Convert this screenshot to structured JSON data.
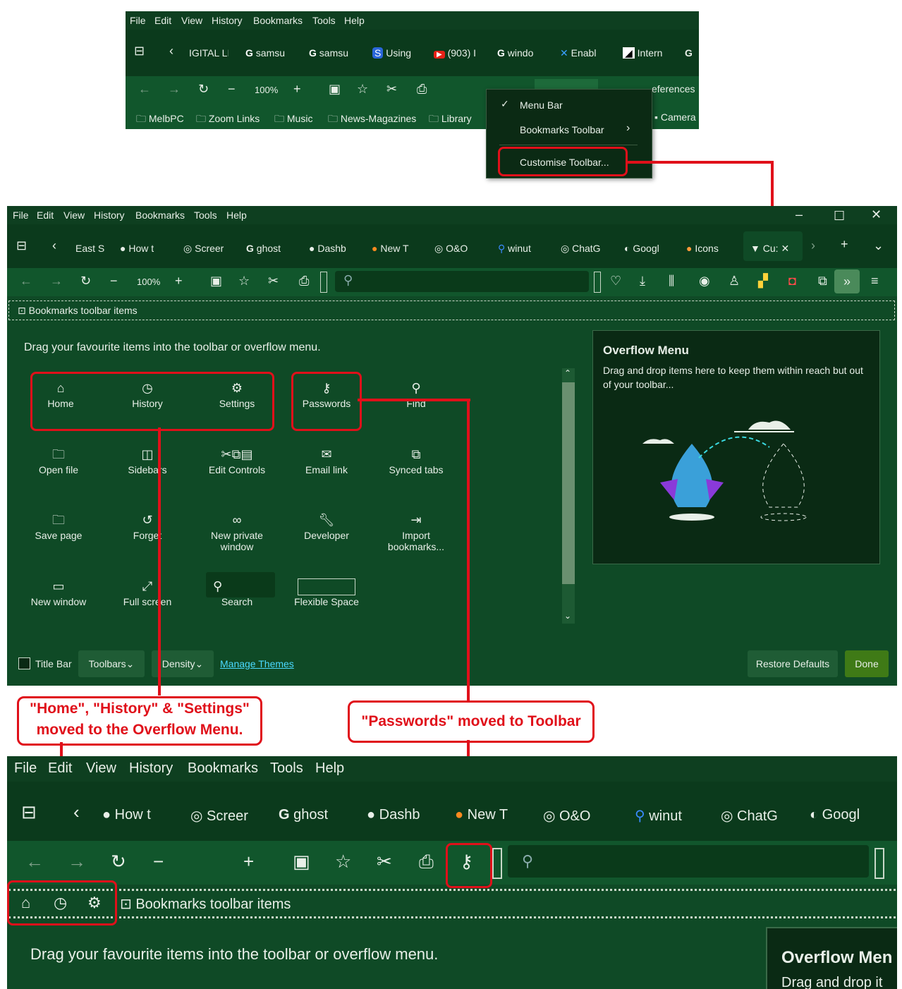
{
  "menu_bar": {
    "file": "File",
    "edit": "Edit",
    "view": "View",
    "history": "History",
    "bookmarks": "Bookmarks",
    "tools": "Tools",
    "help": "Help"
  },
  "shotA": {
    "tabs": [
      "IGITAL LI",
      "samsu",
      "samsu",
      "Using",
      "(903) I",
      "windo",
      "Enabl",
      "Intern"
    ],
    "zoom": "100%",
    "overlay_text": "eferences",
    "bookmarks": [
      "MelbPC",
      "Zoom Links",
      "Music",
      "News-Magazines",
      "Library",
      "Camera"
    ]
  },
  "context_menu": {
    "items": [
      "Menu Bar",
      "Bookmarks Toolbar",
      "Customise Toolbar..."
    ]
  },
  "shotB": {
    "tabs": [
      "East S",
      "How t",
      "Screer",
      "ghost",
      "Dashb",
      "New T",
      "O&O",
      "winut",
      "ChatG",
      "Googl",
      "Icons",
      "Cu:"
    ],
    "zoom": "100%",
    "bookmarks_toolbar_label": "Bookmarks toolbar items",
    "drag_instruction": "Drag your favourite items into the toolbar or overflow menu.",
    "items": [
      {
        "label": "Home",
        "icon": "home-icon"
      },
      {
        "label": "History",
        "icon": "clock-icon"
      },
      {
        "label": "Settings",
        "icon": "gear-icon"
      },
      {
        "label": "Passwords",
        "icon": "key-icon"
      },
      {
        "label": "Find",
        "icon": "search-icon"
      },
      {
        "label": "Open file",
        "icon": "open-file-icon"
      },
      {
        "label": "Sidebars",
        "icon": "sidebar-icon"
      },
      {
        "label": "Edit Controls",
        "icon": "edit-controls-icon"
      },
      {
        "label": "Email link",
        "icon": "email-icon"
      },
      {
        "label": "Synced tabs",
        "icon": "synced-tabs-icon"
      },
      {
        "label": "Save page",
        "icon": "save-page-icon"
      },
      {
        "label": "Forget",
        "icon": "forget-icon"
      },
      {
        "label": "New private window",
        "icon": "private-mask-icon"
      },
      {
        "label": "Developer",
        "icon": "wrench-icon"
      },
      {
        "label": "Import bookmarks...",
        "icon": "import-icon"
      },
      {
        "label": "New window",
        "icon": "window-icon"
      },
      {
        "label": "Full screen",
        "icon": "fullscreen-icon"
      },
      {
        "label": "Search",
        "icon": "search-icon"
      },
      {
        "label": "Flexible Space",
        "icon": "flexible-space-icon"
      }
    ],
    "overflow_title": "Overflow Menu",
    "overflow_desc": "Drag and drop items here to keep them within reach but out of your toolbar...",
    "footer": {
      "title_bar": "Title Bar",
      "toolbars": "Toolbars",
      "density": "Density",
      "manage_themes": "Manage Themes",
      "restore": "Restore Defaults",
      "done": "Done"
    }
  },
  "callouts": {
    "left": "\"Home\", \"History\" & \"Settings\" moved to the Overflow Menu.",
    "right": "\"Passwords\" moved to Toolbar"
  },
  "shotC": {
    "tabs": [
      "How t",
      "Screer",
      "ghost",
      "Dashb",
      "New T",
      "O&O",
      "winut",
      "ChatG",
      "Googl"
    ],
    "bookmarks_toolbar_label": "Bookmarks toolbar items",
    "drag_instruction": "Drag your favourite items into the toolbar or overflow menu.",
    "overflow_title": "Overflow Men",
    "overflow_desc": "Drag and drop it"
  },
  "colors": {
    "bg": "#0f4a26",
    "accent_red": "#e0101a",
    "done": "#3f7a16"
  }
}
